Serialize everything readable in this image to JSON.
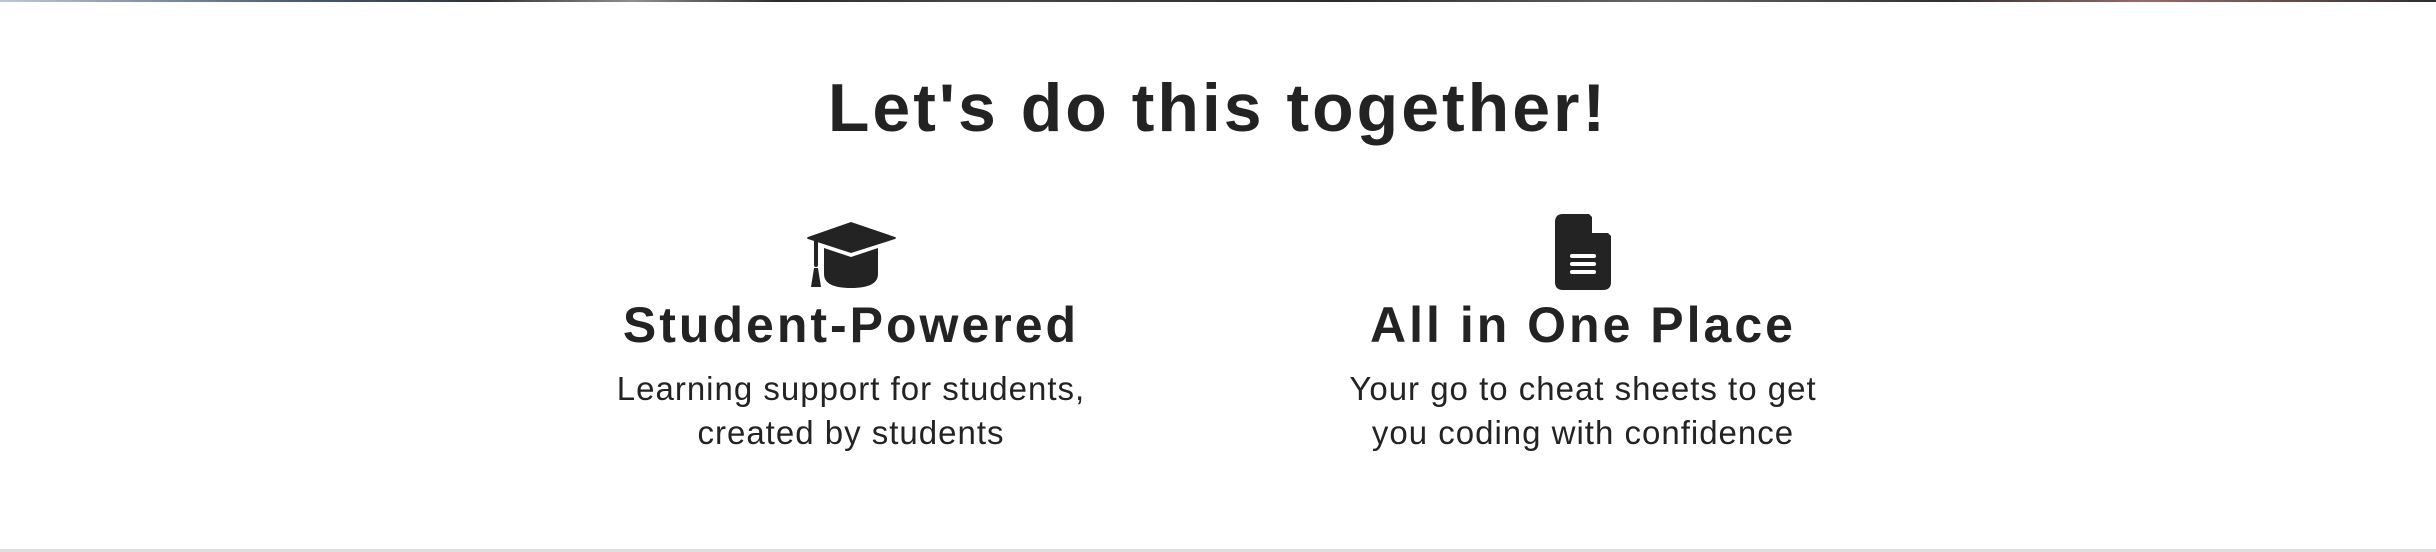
{
  "section": {
    "title": "Let's do this together!"
  },
  "features": [
    {
      "icon": "graduation-cap-icon",
      "title": "Student-Powered",
      "description": "Learning support for students, created by students"
    },
    {
      "icon": "document-icon",
      "title": "All in One Place",
      "description": "Your go to cheat sheets to get you coding with confidence"
    }
  ],
  "colors": {
    "text": "#232323",
    "background": "#ffffff",
    "divider": "#dedede"
  }
}
